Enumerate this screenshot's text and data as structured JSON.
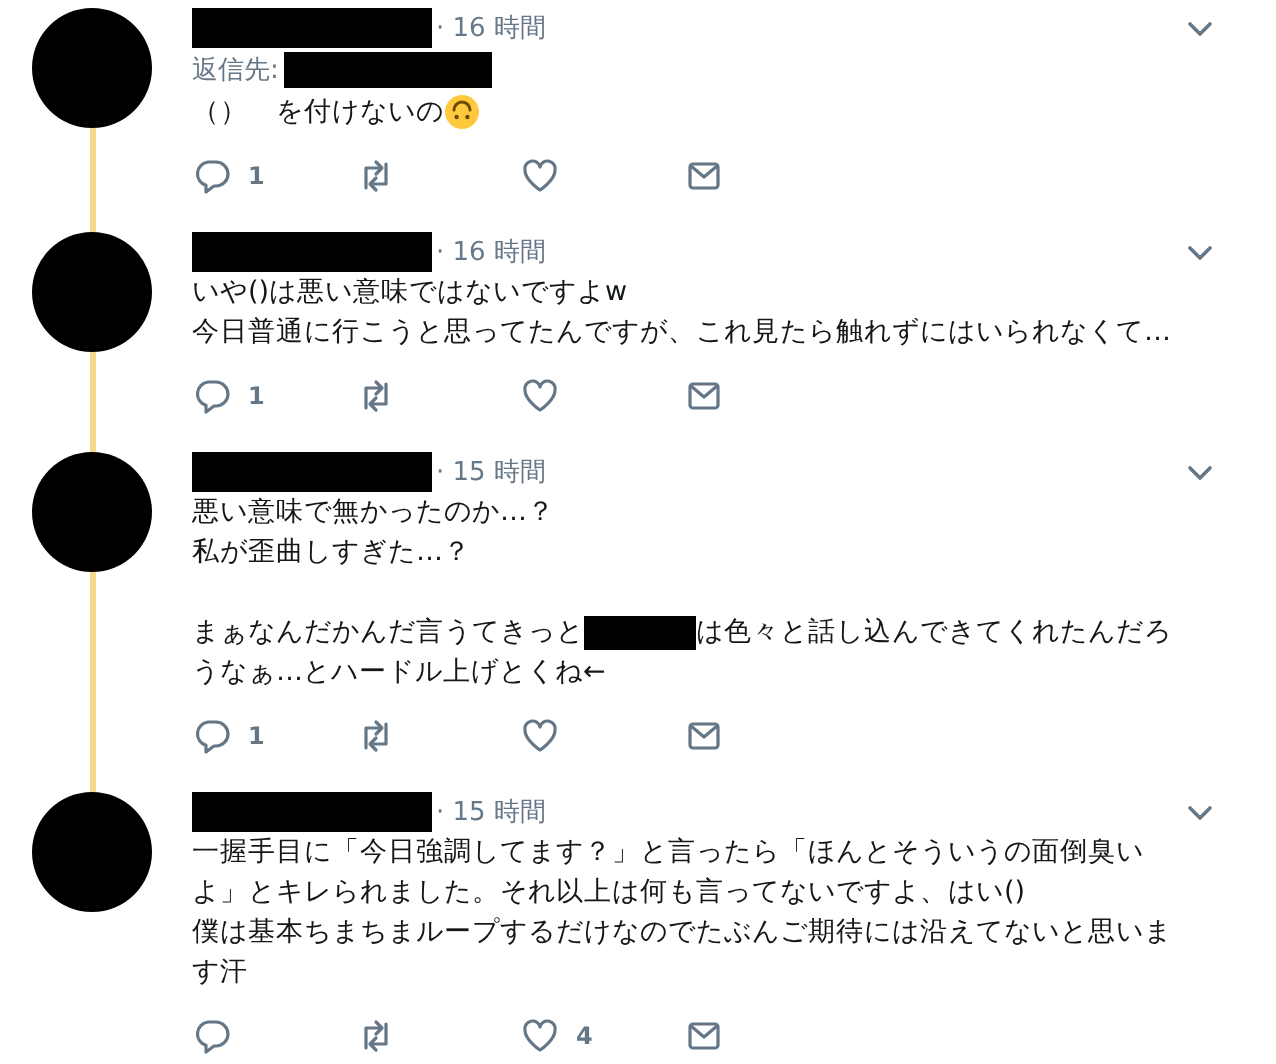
{
  "tweets": [
    {
      "time": "· 16 時間",
      "reply_to": {
        "label": "返信先:"
      },
      "thread_continues": true,
      "body": [
        [
          {
            "kind": "text",
            "text": "（）　を付けないの"
          },
          {
            "kind": "emoji"
          }
        ]
      ],
      "actions": {
        "reply_count": "1"
      }
    },
    {
      "time": "· 16 時間",
      "thread_continues": true,
      "body": [
        [
          {
            "kind": "text",
            "text": "いや()は悪い意味ではないですよw"
          }
        ],
        [
          {
            "kind": "text",
            "text": "今日普通に行こうと思ってたんですが、これ見たら触れずにはいられなくて…"
          }
        ]
      ],
      "actions": {
        "reply_count": "1"
      }
    },
    {
      "time": "· 15 時間",
      "thread_continues": true,
      "body": [
        [
          {
            "kind": "text",
            "text": "悪い意味で無かったのか…？"
          }
        ],
        [
          {
            "kind": "text",
            "text": "私が歪曲しすぎた…？"
          }
        ],
        {
          "space_before": true,
          "parts": [
            {
              "kind": "text",
              "text": "まぁなんだかんだ言うてきっと"
            },
            {
              "kind": "redacted"
            },
            {
              "kind": "text",
              "text": "は色々と話し込んできてくれたんだろ"
            }
          ]
        },
        [
          {
            "kind": "text",
            "text": "うなぁ…とハードル上げとくね←"
          }
        ]
      ],
      "actions": {
        "reply_count": "1"
      }
    },
    {
      "time": "· 15 時間",
      "thread_continues": false,
      "body": [
        [
          {
            "kind": "text",
            "text": "一握手目に「今日強調してます？」と言ったら「ほんとそういうの面倒臭いよ」とキレられました。それ以上は何も言ってないですよ、はい()"
          }
        ],
        [
          {
            "kind": "text",
            "text": "僕は基本ちまちまループするだけなのでたぶんご期待には沿えてないと思います汗"
          }
        ]
      ],
      "actions": {
        "like_count": "4"
      }
    }
  ]
}
